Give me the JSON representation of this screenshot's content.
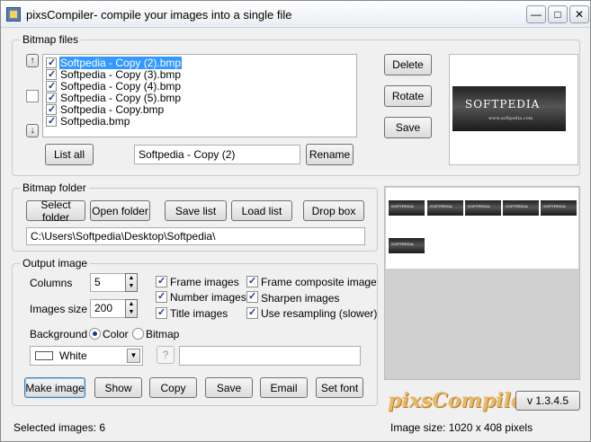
{
  "window": {
    "title": "pixsCompiler- compile your images into a single file"
  },
  "bitmap_files": {
    "group_label": "Bitmap files",
    "items": [
      {
        "name": "Softpedia - Copy (2).bmp",
        "checked": true,
        "selected": true
      },
      {
        "name": "Softpedia - Copy (3).bmp",
        "checked": true,
        "selected": false
      },
      {
        "name": "Softpedia - Copy (4).bmp",
        "checked": true,
        "selected": false
      },
      {
        "name": "Softpedia - Copy (5).bmp",
        "checked": true,
        "selected": false
      },
      {
        "name": "Softpedia - Copy.bmp",
        "checked": true,
        "selected": false
      },
      {
        "name": "Softpedia.bmp",
        "checked": true,
        "selected": false
      }
    ],
    "up_arrow": "↑",
    "down_arrow": "↓",
    "list_all_label": "List all",
    "rename_value": "Softpedia - Copy (2)",
    "rename_label": "Rename",
    "delete_label": "Delete",
    "rotate_label": "Rotate",
    "save_label": "Save"
  },
  "preview": {
    "logo_text": "SOFTPEDIA",
    "logo_url": "www.softpedia.com"
  },
  "bitmap_folder": {
    "group_label": "Bitmap folder",
    "select_folder_label": "Select folder",
    "open_folder_label": "Open folder",
    "save_list_label": "Save list",
    "load_list_label": "Load list",
    "drop_box_label": "Drop box",
    "path": "C:\\Users\\Softpedia\\Desktop\\Softpedia\\"
  },
  "output_image": {
    "group_label": "Output image",
    "columns_label": "Columns",
    "columns_value": "5",
    "images_size_label": "Images size",
    "images_size_value": "200",
    "background_label": "Background",
    "color_label": "Color",
    "bitmap_label": "Bitmap",
    "background_mode": "color",
    "color_value": "White",
    "question_label": "?",
    "options": {
      "frame_images": "Frame images",
      "number_images": "Number images",
      "title_images": "Title images",
      "frame_composite": "Frame composite image",
      "sharpen_images": "Sharpen images",
      "use_resampling": "Use resampling (slower)"
    },
    "make_image_label": "Make image",
    "show_label": "Show",
    "copy_label": "Copy",
    "save_label": "Save",
    "email_label": "Email",
    "set_font_label": "Set font"
  },
  "brand": "pixsCompiler",
  "version": "v 1.3.4.5",
  "status": {
    "selected_images": "Selected images: 6",
    "image_size": "Image size: 1020 x 408 pixels"
  },
  "colors": {
    "selection": "#3399ff",
    "brand": "#e9b86a"
  }
}
